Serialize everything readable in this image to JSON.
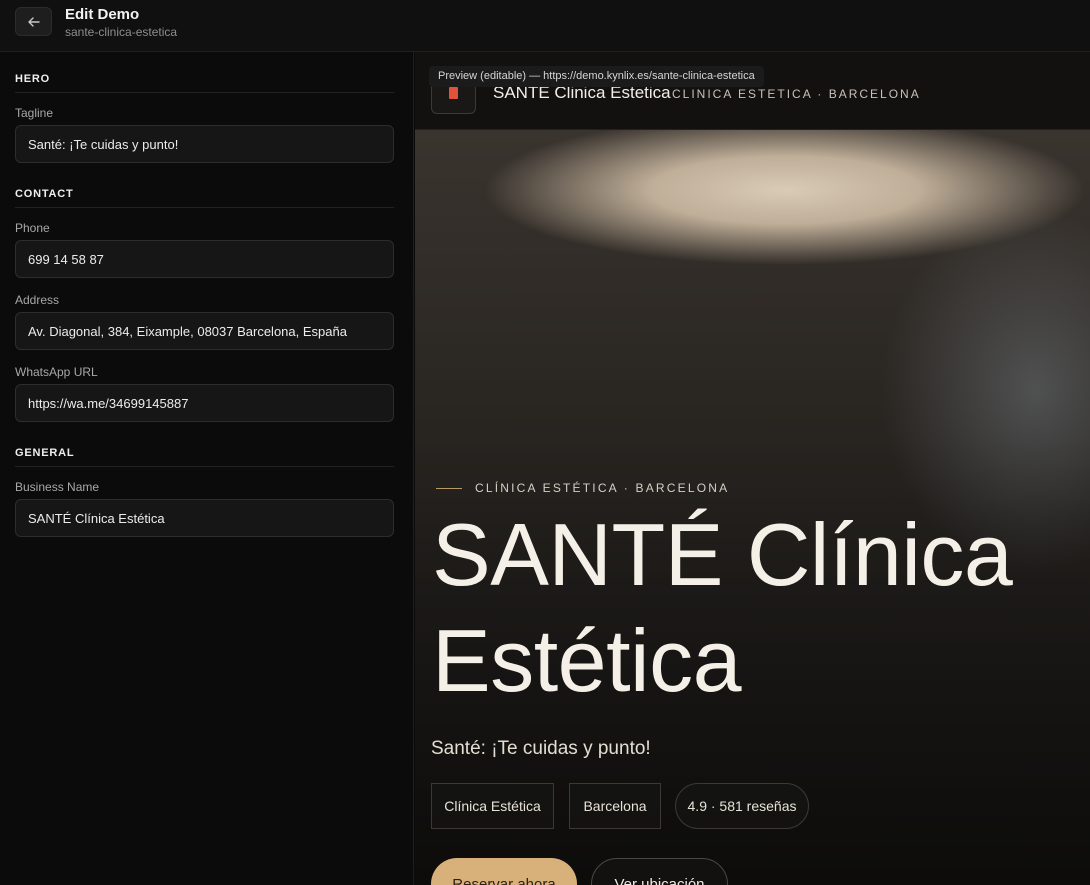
{
  "header": {
    "title": "Edit Demo",
    "slug": "sante-clinica-estetica",
    "back_icon": "arrow-left-icon"
  },
  "form": {
    "hero": {
      "section_title": "HERO",
      "tagline_label": "Tagline",
      "tagline_value": "Santé: ¡Te cuidas y punto!"
    },
    "contact": {
      "section_title": "CONTACT",
      "phone_label": "Phone",
      "phone_value": "699 14 58 87",
      "address_label": "Address",
      "address_value": "Av. Diagonal, 384, Eixample, 08037 Barcelona, España",
      "whatsapp_label": "WhatsApp URL",
      "whatsapp_value": "https://wa.me/34699145887"
    },
    "general": {
      "section_title": "GENERAL",
      "business_label": "Business Name",
      "business_value": "SANTÉ Clínica Estética"
    }
  },
  "preview": {
    "tooltip": "Preview (editable) — https://demo.kynlix.es/sante-clinica-estetica",
    "brand_name": "SANTE Clinica Estetica",
    "brand_sub": "CLINICA ESTETICA · BARCELONA",
    "eyebrow": "CLÍNICA ESTÉTICA · BARCELONA",
    "title_line1": "SANTÉ Clínica",
    "title_line2": "Estética",
    "tagline": "Santé: ¡Te cuidas y punto!",
    "chips": [
      "Clínica Estética",
      "Barcelona",
      "4.9 · 581 reseñas"
    ],
    "primary_button": "Reservar ahora",
    "secondary_button": "Ver ubicación",
    "accent_color": "#d7b07a"
  }
}
